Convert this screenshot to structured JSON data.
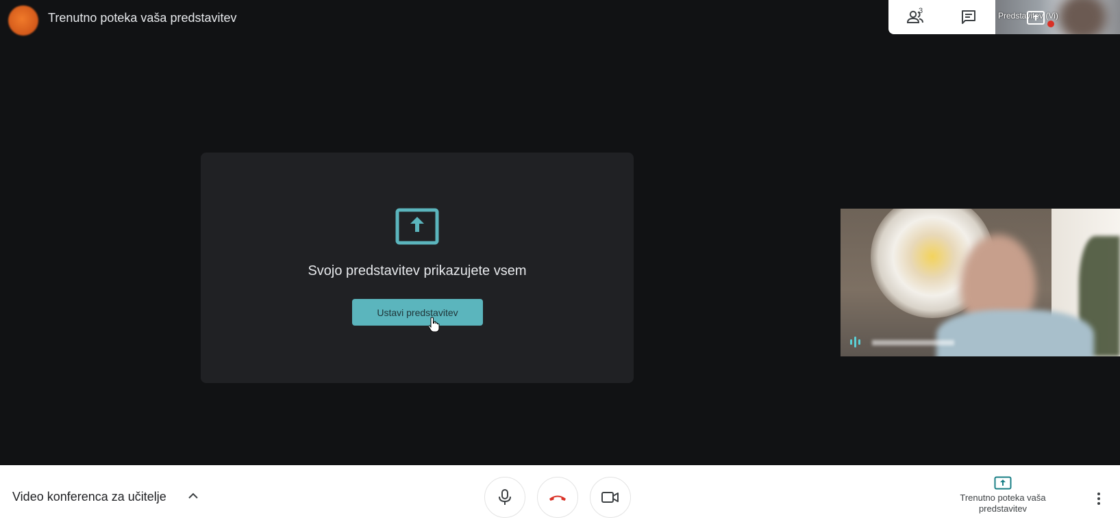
{
  "header": {
    "presenting_title": "Trenutno poteka vaša predstavitev"
  },
  "top_tray": {
    "people_count": "3",
    "self_tile_label": "Predstavitev (Vi)"
  },
  "present_card": {
    "message": "Svojo predstavitev prikazujete vsem",
    "stop_button_label": "Ustavi predstavitev"
  },
  "bottom_bar": {
    "meeting_title": "Video konferenca za učitelje",
    "present_status_label": "Trenutno poteka vaša predstavitev"
  },
  "colors": {
    "accent": "#5bb5bd",
    "icon_teal": "#1a7f86",
    "hangup_red": "#d93025",
    "background": "#111214",
    "card": "#202124"
  },
  "icons": [
    "present-to-all-icon",
    "people-icon",
    "chat-icon",
    "mic-icon",
    "hang-up-icon",
    "camera-icon",
    "chevron-up-icon",
    "more-vert-icon",
    "audio-level-icon",
    "cursor-hand-icon"
  ]
}
